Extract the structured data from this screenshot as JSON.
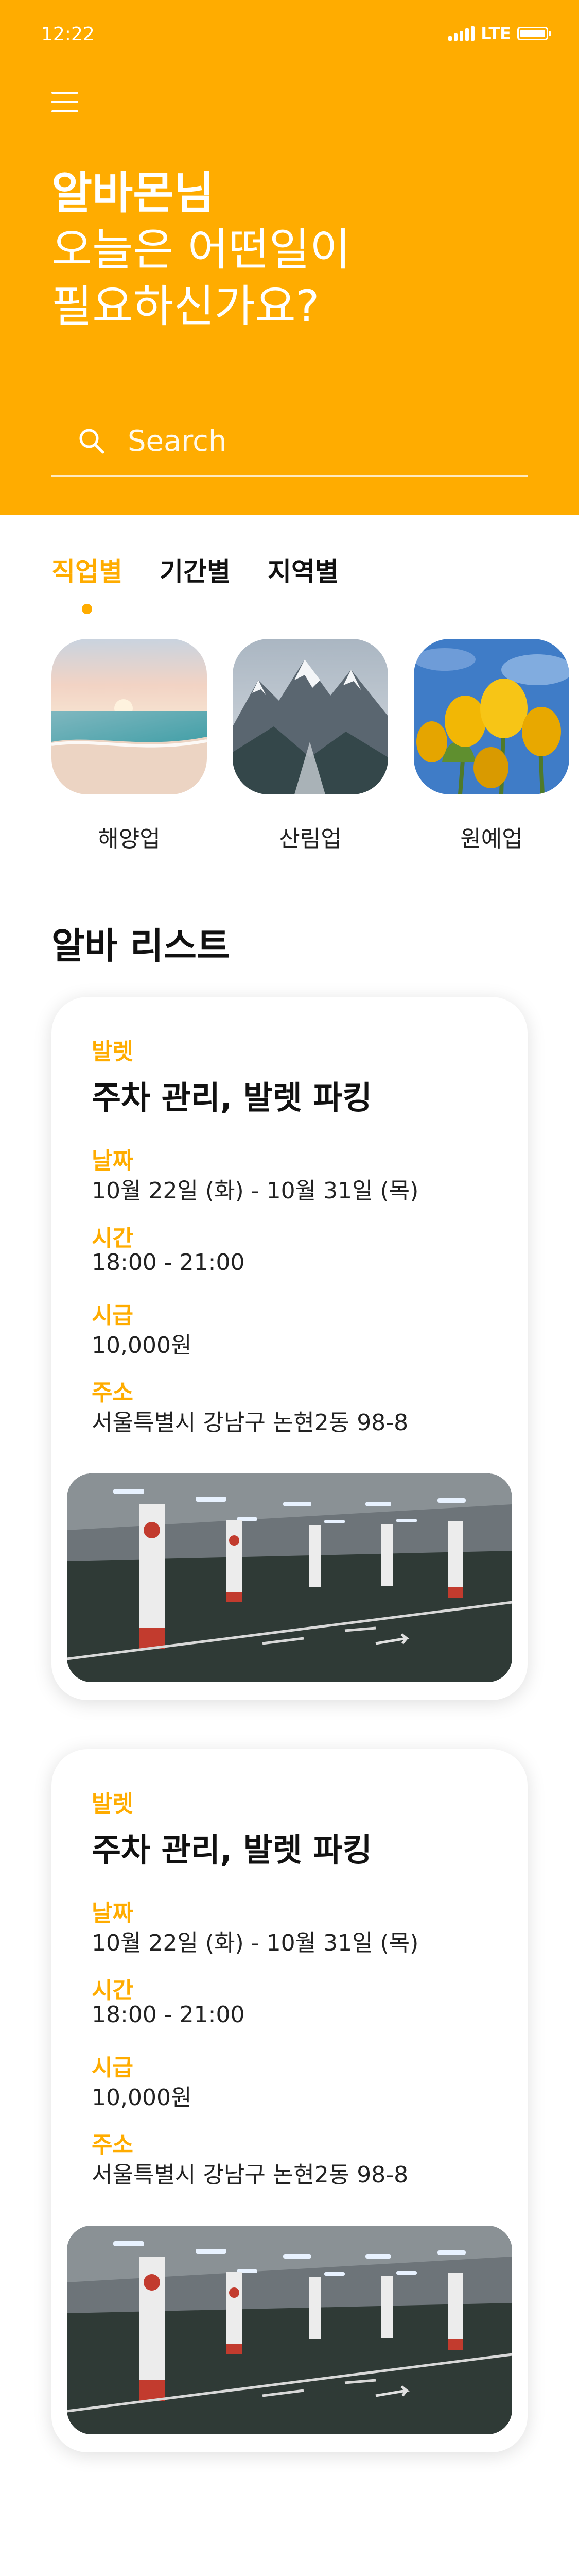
{
  "status": {
    "time": "12:22",
    "network": "LTE"
  },
  "greeting": {
    "name": "알바몬님",
    "line1": "오늘은 어떤일이",
    "line2": "필요하신가요?"
  },
  "search": {
    "placeholder": "Search"
  },
  "tabs": [
    {
      "label": "직업별",
      "active": true
    },
    {
      "label": "기간별",
      "active": false
    },
    {
      "label": "지역별",
      "active": false
    }
  ],
  "categories": [
    {
      "label": "해양업",
      "icon": "beach-image"
    },
    {
      "label": "산림업",
      "icon": "mountain-image"
    },
    {
      "label": "원예업",
      "icon": "tulip-image"
    }
  ],
  "list": {
    "title": "알바 리스트",
    "jobs": [
      {
        "category": "발렛",
        "title": "주차 관리, 발렛 파킹",
        "date_label": "날짜",
        "date": "10월 22일 (화) - 10월 31일 (목)",
        "time_label": "시간",
        "time": "18:00 - 21:00",
        "wage_label": "시급",
        "wage": "10,000원",
        "address_label": "주소",
        "address": "서울특별시 강남구 논현2동 98-8",
        "image": "parking-garage-photo"
      },
      {
        "category": "발렛",
        "title": "주차 관리, 발렛 파킹",
        "date_label": "날짜",
        "date": "10월 22일 (화) - 10월 31일 (목)",
        "time_label": "시간",
        "time": "18:00 - 21:00",
        "wage_label": "시급",
        "wage": "10,000원",
        "address_label": "주소",
        "address": "서울특별시 강남구 논현2동 98-8",
        "image": "parking-garage-photo"
      }
    ]
  },
  "colors": {
    "accent": "#FFAC00",
    "text": "#111111",
    "background": "#FFFFFF"
  }
}
